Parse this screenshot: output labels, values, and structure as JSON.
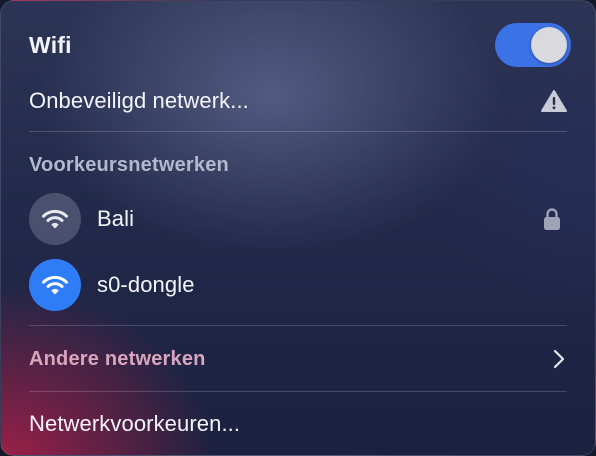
{
  "wifi": {
    "title": "Wifi",
    "enabled": true
  },
  "current_network": {
    "label": "Onbeveiligd netwerk...",
    "icon": "warning-triangle-icon"
  },
  "preferred": {
    "header": "Voorkeursnetwerken",
    "networks": [
      {
        "name": "Bali",
        "icon": "wifi-icon",
        "secured": true,
        "connected": false
      },
      {
        "name": "s0-dongle",
        "icon": "wifi-icon",
        "secured": false,
        "connected": true
      }
    ]
  },
  "other": {
    "label": "Andere netwerken",
    "icon": "chevron-right-icon"
  },
  "settings": {
    "label": "Netwerkvoorkeuren..."
  },
  "colors": {
    "toggle_on": "#3b72e6",
    "connected_icon": "#2f7df6",
    "other_networks_text": "#d9a5bd"
  }
}
